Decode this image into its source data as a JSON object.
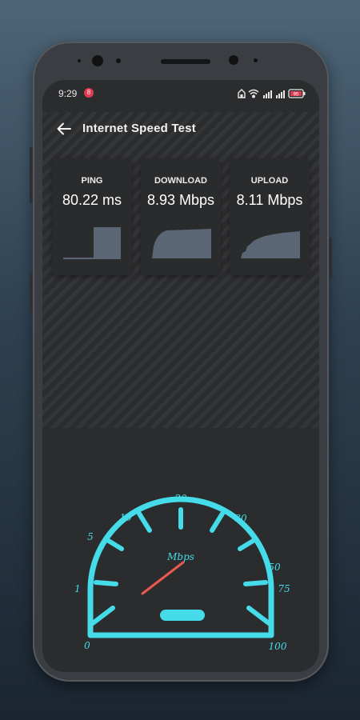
{
  "status_bar": {
    "time": "9:29",
    "notification_badge": "8",
    "battery_level": "95"
  },
  "app_bar": {
    "title": "Internet Speed Test",
    "back_icon": "arrow-left-icon"
  },
  "cards": [
    {
      "label": "PING",
      "value": "80.22 ms"
    },
    {
      "label": "DOWNLOAD",
      "value": "8.93 Mbps"
    },
    {
      "label": "UPLOAD",
      "value": "8.11 Mbps"
    }
  ],
  "gauge": {
    "unit": "Mbps",
    "scale_labels": [
      "0",
      "1",
      "5",
      "10",
      "20",
      "30",
      "50",
      "75",
      "100"
    ],
    "needle_scale_label": "1",
    "accent_color": "#46dbe8",
    "needle_color": "#e85a4f"
  },
  "colors": {
    "background": "#2b2c2e",
    "card": "#2a2b2d",
    "graph_fill": "#5b6675"
  }
}
